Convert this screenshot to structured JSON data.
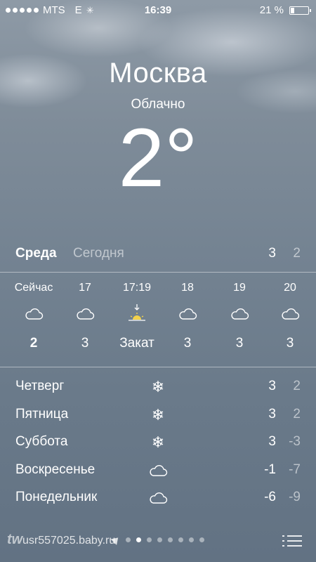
{
  "status_bar": {
    "carrier": "MTS",
    "network": "E",
    "time": "16:39",
    "battery_text": "21 %",
    "battery_level": 0.21
  },
  "location": {
    "city": "Москва",
    "condition": "Облачно",
    "temperature": "2°"
  },
  "today": {
    "day": "Среда",
    "label": "Сегодня",
    "high": "3",
    "low": "2"
  },
  "hourly": [
    {
      "time": "Сейчас",
      "icon": "cloud-icon",
      "value": "2"
    },
    {
      "time": "17",
      "icon": "cloud-icon",
      "value": "3"
    },
    {
      "time": "17:19",
      "icon": "sunset-icon",
      "value": "Закат"
    },
    {
      "time": "18",
      "icon": "cloud-icon",
      "value": "3"
    },
    {
      "time": "19",
      "icon": "cloud-icon",
      "value": "3"
    },
    {
      "time": "20",
      "icon": "cloud-icon",
      "value": "3"
    }
  ],
  "daily": [
    {
      "day": "Четверг",
      "icon": "snowflake-icon",
      "high": "3",
      "low": "2"
    },
    {
      "day": "Пятница",
      "icon": "snowflake-icon",
      "high": "3",
      "low": "2"
    },
    {
      "day": "Суббота",
      "icon": "snowflake-icon",
      "high": "3",
      "low": "-3"
    },
    {
      "day": "Воскресенье",
      "icon": "cloud-icon",
      "high": "-1",
      "low": "-7"
    },
    {
      "day": "Понедельник",
      "icon": "cloud-icon",
      "high": "-6",
      "low": "-9"
    }
  ],
  "footer": {
    "watermark": "usr557025.baby.ru",
    "page_count": 8,
    "active_page": 1
  },
  "colors": {
    "text": "#ffffff",
    "muted": "rgba(255,255,255,0.55)",
    "sky_top": "#8e9aa6",
    "sky_bottom": "#627283"
  }
}
